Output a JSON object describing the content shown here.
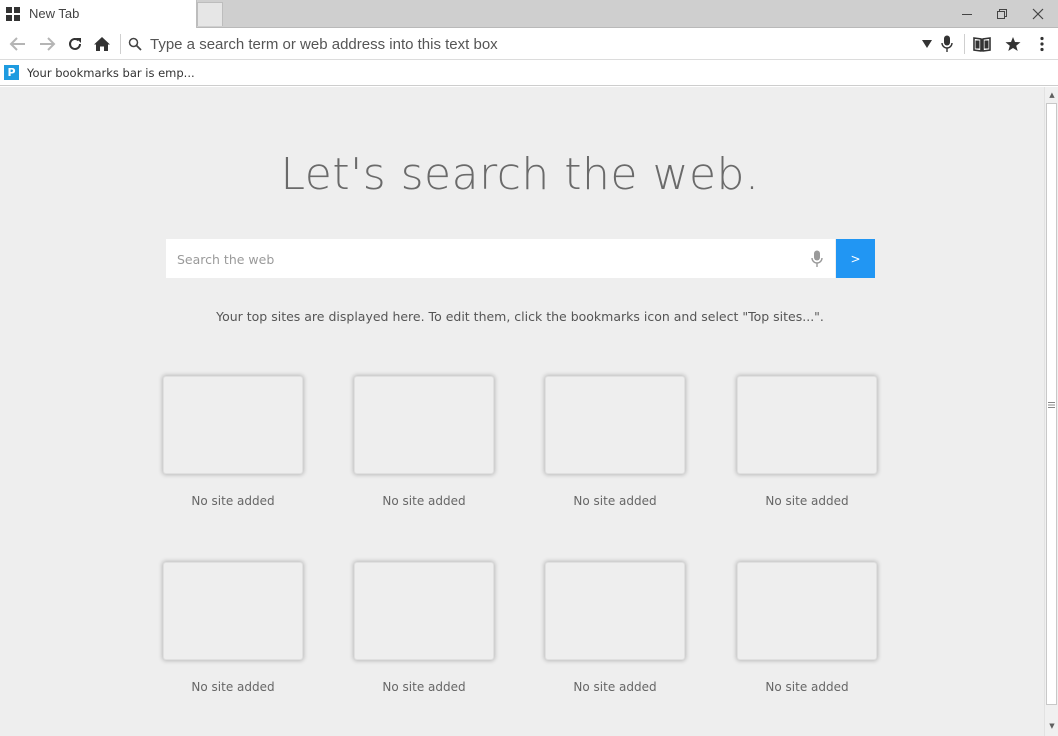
{
  "window": {
    "tab_title": "New Tab"
  },
  "toolbar": {
    "address_placeholder": "Type a search term or web address into this text box"
  },
  "bookmarks_bar": {
    "text": "Your bookmarks bar is emp..."
  },
  "page": {
    "heading": "Let's search the web.",
    "search_placeholder": "Search the web",
    "search_go_label": ">",
    "hint": "Your top sites are displayed here. To edit them, click the bookmarks icon and select \"Top sites...\".",
    "top_sites": [
      {
        "label": "No site added"
      },
      {
        "label": "No site added"
      },
      {
        "label": "No site added"
      },
      {
        "label": "No site added"
      },
      {
        "label": "No site added"
      },
      {
        "label": "No site added"
      },
      {
        "label": "No site added"
      },
      {
        "label": "No site added"
      }
    ]
  },
  "colors": {
    "accent": "#2196f3",
    "page_background": "#eeeeee"
  }
}
